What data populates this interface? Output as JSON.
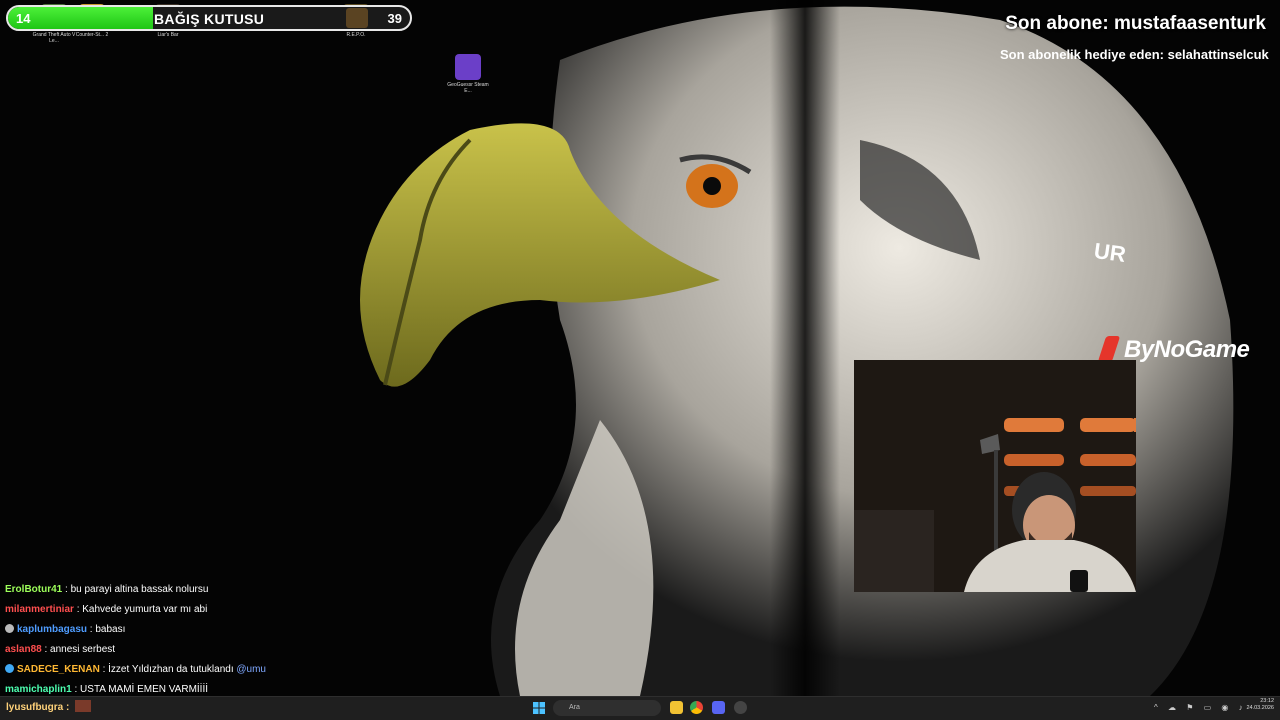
{
  "overlay": {
    "donation": {
      "start_value": "14",
      "title": "BAĞIŞ KUTUSU",
      "goal_value": "39",
      "progress": 0.36
    },
    "last_subscriber": "Son abone: mustafaasenturk",
    "gift_subscriber": "Son abonelik hediye eden: selahattinselcuk",
    "brand": "ByNoGame",
    "fragment_text": "UR"
  },
  "desktop_icons": [
    {
      "label": "Grand Theft Auto V Le...",
      "color": "#4b6f3a"
    },
    {
      "label": "Counter-St... 2",
      "color": "#c89a2b"
    },
    {
      "label": "Liar's Bar",
      "color": "#3a2f25"
    },
    {
      "label": "R.E.P.O.",
      "color": "#5a4a22"
    },
    {
      "label": "GeoGuessr Steam E...",
      "color": "#6b3fc8"
    }
  ],
  "chat": {
    "messages": [
      {
        "user": "ErolBotur41",
        "color": "#9dff5a",
        "text": "bu parayi altina bassak nolursu",
        "badge": ""
      },
      {
        "user": "milanmertiniar",
        "color": "#ff4f4f",
        "text": "Kahvede yumurta var mı abi",
        "badge": ""
      },
      {
        "user": "kaplumbagasu",
        "color": "#4f9dff",
        "text": "babası",
        "badge": "#bbbbbb"
      },
      {
        "user": "aslan88",
        "color": "#ff4f4f",
        "text": "annesi serbest",
        "badge": ""
      },
      {
        "user": "SADECE_KENAN",
        "color": "#ffb833",
        "text": "İzzet Yıldızhan da tutuklandı",
        "mention": "@umu",
        "badge": "#3fa9f5"
      },
      {
        "user": "mamichaplin1",
        "color": "#4dffb0",
        "text": "USTA MAMİ EMEN VARMİİİİ",
        "badge": ""
      }
    ],
    "bottom_user": "lyusufbugra"
  },
  "taskbar": {
    "search_placeholder": "Ara",
    "time": "23:12",
    "date": "24.03.2026"
  }
}
